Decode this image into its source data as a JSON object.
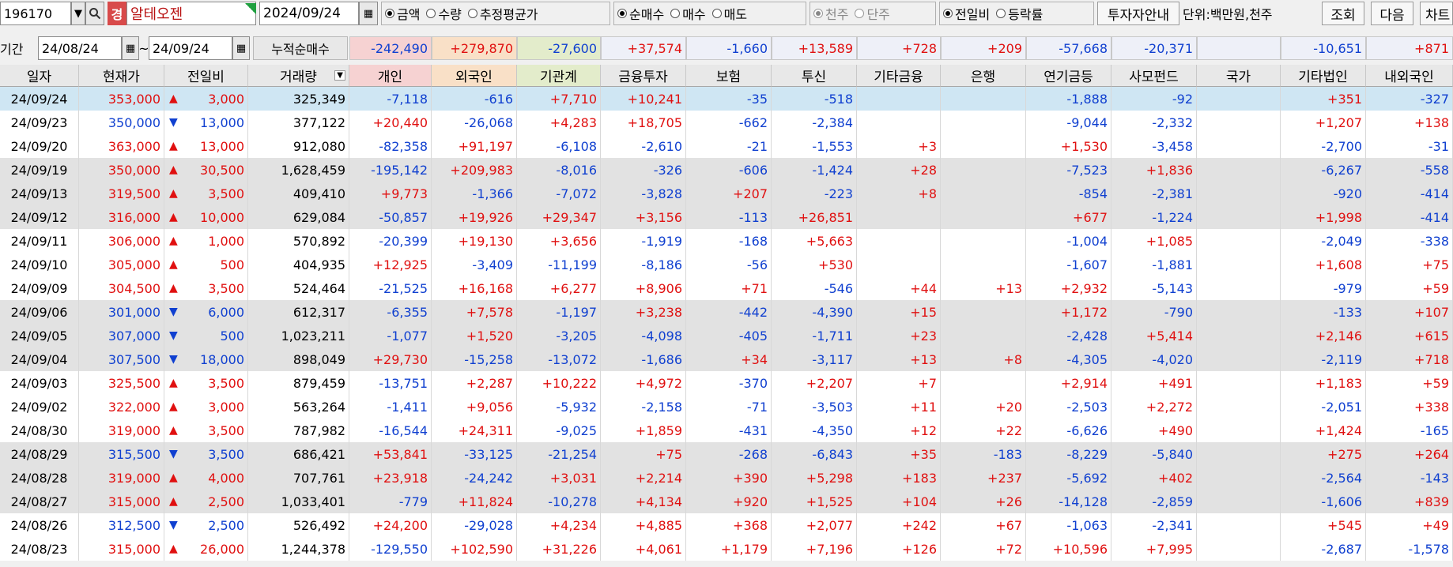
{
  "toolbar": {
    "code": "196170",
    "badge": "경",
    "stock_name": "알테오젠",
    "date": "2024/09/24",
    "group1": [
      "금액",
      "수량",
      "추정평균가"
    ],
    "group1_selected": 0,
    "group2": [
      "순매수",
      "매수",
      "매도"
    ],
    "group2_selected": 0,
    "group3": [
      "천주",
      "단주"
    ],
    "group3_selected": 0,
    "group4": [
      "전일비",
      "등락률"
    ],
    "group4_selected": 0,
    "guide_button": "투자자안내",
    "unit": "단위:백만원,천주",
    "search_button": "조회",
    "next_button": "다음",
    "chart_button": "차트"
  },
  "period": {
    "label": "기간",
    "from": "24/08/24",
    "tilde": "~",
    "to": "24/09/24",
    "cum_label": "누적순매수",
    "cum_values": [
      "-242,490",
      "+279,870",
      "-27,600",
      "+37,574",
      "-1,660",
      "+13,589",
      "+728",
      "+209",
      "-57,668",
      "-20,371",
      "",
      "-10,651",
      "+871"
    ]
  },
  "columns": [
    "일자",
    "현재가",
    "전일비",
    "거래량",
    "개인",
    "외국인",
    "기관계",
    "금융투자",
    "보험",
    "투신",
    "기타금융",
    "은행",
    "연기금등",
    "사모펀드",
    "국가",
    "기타법인",
    "내외국인"
  ],
  "rows": [
    [
      "24/09/24",
      "353,000",
      "▲",
      "3,000",
      "325,349",
      "-7,118",
      "-616",
      "+7,710",
      "+10,241",
      "-35",
      "-518",
      "",
      "",
      "-1,888",
      "-92",
      "",
      "+351",
      "-327"
    ],
    [
      "24/09/23",
      "350,000",
      "▼",
      "13,000",
      "377,122",
      "+20,440",
      "-26,068",
      "+4,283",
      "+18,705",
      "-662",
      "-2,384",
      "",
      "",
      "-9,044",
      "-2,332",
      "",
      "+1,207",
      "+138"
    ],
    [
      "24/09/20",
      "363,000",
      "▲",
      "13,000",
      "912,080",
      "-82,358",
      "+91,197",
      "-6,108",
      "-2,610",
      "-21",
      "-1,553",
      "+3",
      "",
      "+1,530",
      "-3,458",
      "",
      "-2,700",
      "-31"
    ],
    [
      "24/09/19",
      "350,000",
      "▲",
      "30,500",
      "1,628,459",
      "-195,142",
      "+209,983",
      "-8,016",
      "-326",
      "-606",
      "-1,424",
      "+28",
      "",
      "-7,523",
      "+1,836",
      "",
      "-6,267",
      "-558"
    ],
    [
      "24/09/13",
      "319,500",
      "▲",
      "3,500",
      "409,410",
      "+9,773",
      "-1,366",
      "-7,072",
      "-3,828",
      "+207",
      "-223",
      "+8",
      "",
      "-854",
      "-2,381",
      "",
      "-920",
      "-414"
    ],
    [
      "24/09/12",
      "316,000",
      "▲",
      "10,000",
      "629,084",
      "-50,857",
      "+19,926",
      "+29,347",
      "+3,156",
      "-113",
      "+26,851",
      "",
      "",
      "+677",
      "-1,224",
      "",
      "+1,998",
      "-414"
    ],
    [
      "24/09/11",
      "306,000",
      "▲",
      "1,000",
      "570,892",
      "-20,399",
      "+19,130",
      "+3,656",
      "-1,919",
      "-168",
      "+5,663",
      "",
      "",
      "-1,004",
      "+1,085",
      "",
      "-2,049",
      "-338"
    ],
    [
      "24/09/10",
      "305,000",
      "▲",
      "500",
      "404,935",
      "+12,925",
      "-3,409",
      "-11,199",
      "-8,186",
      "-56",
      "+530",
      "",
      "",
      "-1,607",
      "-1,881",
      "",
      "+1,608",
      "+75"
    ],
    [
      "24/09/09",
      "304,500",
      "▲",
      "3,500",
      "524,464",
      "-21,525",
      "+16,168",
      "+6,277",
      "+8,906",
      "+71",
      "-546",
      "+44",
      "+13",
      "+2,932",
      "-5,143",
      "",
      "-979",
      "+59"
    ],
    [
      "24/09/06",
      "301,000",
      "▼",
      "6,000",
      "612,317",
      "-6,355",
      "+7,578",
      "-1,197",
      "+3,238",
      "-442",
      "-4,390",
      "+15",
      "",
      "+1,172",
      "-790",
      "",
      "-133",
      "+107"
    ],
    [
      "24/09/05",
      "307,000",
      "▼",
      "500",
      "1,023,211",
      "-1,077",
      "+1,520",
      "-3,205",
      "-4,098",
      "-405",
      "-1,711",
      "+23",
      "",
      "-2,428",
      "+5,414",
      "",
      "+2,146",
      "+615"
    ],
    [
      "24/09/04",
      "307,500",
      "▼",
      "18,000",
      "898,049",
      "+29,730",
      "-15,258",
      "-13,072",
      "-1,686",
      "+34",
      "-3,117",
      "+13",
      "+8",
      "-4,305",
      "-4,020",
      "",
      "-2,119",
      "+718"
    ],
    [
      "24/09/03",
      "325,500",
      "▲",
      "3,500",
      "879,459",
      "-13,751",
      "+2,287",
      "+10,222",
      "+4,972",
      "-370",
      "+2,207",
      "+7",
      "",
      "+2,914",
      "+491",
      "",
      "+1,183",
      "+59"
    ],
    [
      "24/09/02",
      "322,000",
      "▲",
      "3,000",
      "563,264",
      "-1,411",
      "+9,056",
      "-5,932",
      "-2,158",
      "-71",
      "-3,503",
      "+11",
      "+20",
      "-2,503",
      "+2,272",
      "",
      "-2,051",
      "+338"
    ],
    [
      "24/08/30",
      "319,000",
      "▲",
      "3,500",
      "787,982",
      "-16,544",
      "+24,311",
      "-9,025",
      "+1,859",
      "-431",
      "-4,350",
      "+12",
      "+22",
      "-6,626",
      "+490",
      "",
      "+1,424",
      "-165"
    ],
    [
      "24/08/29",
      "315,500",
      "▼",
      "3,500",
      "686,421",
      "+53,841",
      "-33,125",
      "-21,254",
      "+75",
      "-268",
      "-6,843",
      "+35",
      "-183",
      "-8,229",
      "-5,840",
      "",
      "+275",
      "+264"
    ],
    [
      "24/08/28",
      "319,000",
      "▲",
      "4,000",
      "707,761",
      "+23,918",
      "-24,242",
      "+3,031",
      "+2,214",
      "+390",
      "+5,298",
      "+183",
      "+237",
      "-5,692",
      "+402",
      "",
      "-2,564",
      "-143"
    ],
    [
      "24/08/27",
      "315,000",
      "▲",
      "2,500",
      "1,033,401",
      "-779",
      "+11,824",
      "-10,278",
      "+4,134",
      "+920",
      "+1,525",
      "+104",
      "+26",
      "-14,128",
      "-2,859",
      "",
      "-1,606",
      "+839"
    ],
    [
      "24/08/26",
      "312,500",
      "▼",
      "2,500",
      "526,492",
      "+24,200",
      "-29,028",
      "+4,234",
      "+4,885",
      "+368",
      "+2,077",
      "+242",
      "+67",
      "-1,063",
      "-2,341",
      "",
      "+545",
      "+49"
    ],
    [
      "24/08/23",
      "315,000",
      "▲",
      "26,000",
      "1,244,378",
      "-129,550",
      "+102,590",
      "+31,226",
      "+4,061",
      "+1,179",
      "+7,196",
      "+126",
      "+72",
      "+10,596",
      "+7,995",
      "",
      "-2,687",
      "-1,578"
    ]
  ],
  "colors": {
    "up": "#e01010",
    "down": "#1040d0",
    "selected_row": "#cfe6f3",
    "shaded_row": "#e2e2e2",
    "badge": "#d84a4a"
  }
}
